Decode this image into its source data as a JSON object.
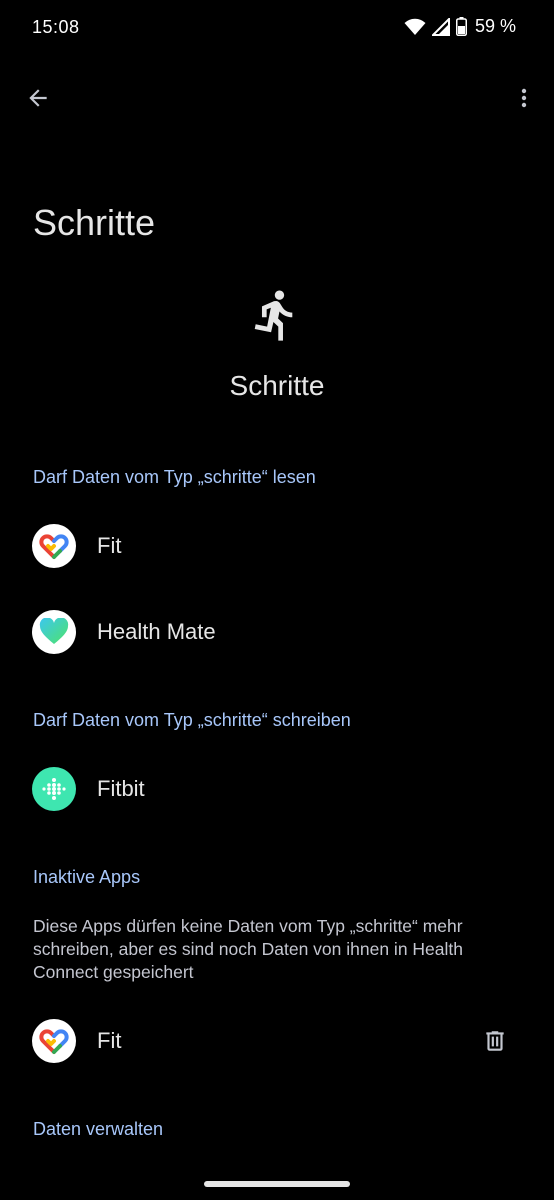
{
  "status_bar": {
    "time": "15:08",
    "battery_percent": "59 %",
    "icons": [
      "wifi-icon",
      "signal-icon",
      "battery-icon"
    ]
  },
  "top_bar": {
    "back_icon": "arrow-back-icon",
    "menu_icon": "more-vert-icon"
  },
  "page": {
    "title": "Schritte",
    "hero_icon": "directions-run-icon",
    "hero_title": "Schritte"
  },
  "sections": {
    "read": {
      "header": "Darf Daten vom Typ „schritte“ lesen",
      "apps": [
        {
          "name": "Fit",
          "icon": "google-fit-icon"
        },
        {
          "name": "Health Mate",
          "icon": "health-mate-icon"
        }
      ]
    },
    "write": {
      "header": "Darf Daten vom Typ „schritte“ schreiben",
      "apps": [
        {
          "name": "Fitbit",
          "icon": "fitbit-icon"
        }
      ]
    },
    "inactive": {
      "header": "Inaktive Apps",
      "description": "Diese Apps dürfen keine Daten vom Typ „schritte“ mehr schreiben, aber es sind noch Daten von ihnen in Health Connect gespeichert",
      "apps": [
        {
          "name": "Fit",
          "icon": "google-fit-icon",
          "action_icon": "delete-icon"
        }
      ]
    },
    "manage": {
      "header": "Daten verwalten"
    }
  },
  "colors": {
    "background": "#000000",
    "section_header": "#a8c7fa",
    "text_primary": "#e6e6e6",
    "fitbit_green": "#3ee6b0"
  }
}
